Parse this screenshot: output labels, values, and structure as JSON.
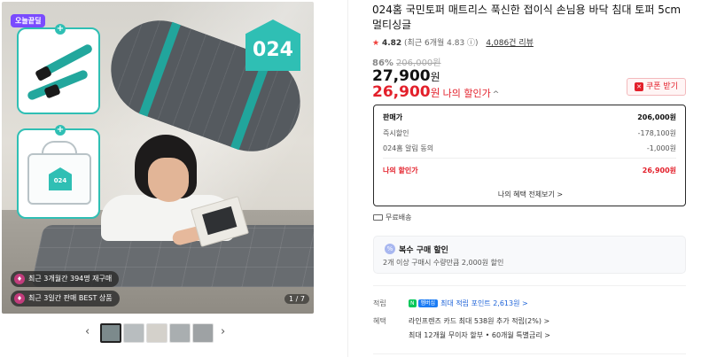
{
  "gallery": {
    "badge_today": "오늘끝딜",
    "brand_logo": "024",
    "bag_logo": "024",
    "overlay_1": "최근 3개월간 394명 재구매",
    "overlay_2": "최근 3일간 판매 BEST 상품",
    "counter": "1 / 7",
    "thumb_count": 5,
    "prev_icon": "chevron-left-icon",
    "next_icon": "chevron-right-icon"
  },
  "product": {
    "title": "024홈 국민토퍼 매트리스 푹신한 접이식 손님용 바닥 침대 토퍼 5cm 멀티싱글",
    "rating_star": "★",
    "rating_score": "4.82",
    "rating_sub": "(최근 6개월 4.83 ⓘ)",
    "reviews": "4,086건 리뷰",
    "discount_pct": "86%",
    "original_price": "206,000원",
    "price": "27,900",
    "price_unit": "원",
    "my_price": "26,900",
    "my_price_unit": "원",
    "my_price_label": "나의 할인가",
    "my_price_caret": "^",
    "coupon_label": "쿠폰 받기"
  },
  "breakdown": {
    "sale_label": "판매가",
    "sale_value": "206,000원",
    "immediate_label": "즉시할인",
    "immediate_value": "-178,100원",
    "alarm_label": "024홈 알림 동의",
    "alarm_value": "-1,000원",
    "mine_label": "나의 할인가",
    "mine_value": "26,900원",
    "link": "나의 혜택 전체보기 >"
  },
  "shipping": {
    "label": "무료배송"
  },
  "multi_buy": {
    "title": "복수 구매 할인",
    "desc": "2개 이상 구매시 수량만큼 2,000원 할인"
  },
  "meta": {
    "point_label": "적립",
    "npay": "N",
    "npay_plus": "멤버십",
    "point_value": "최대 적립 포인트 2,613원 >",
    "benefit_label": "혜택",
    "benefit_value": "라인프렌즈 카드 최대 538원 추가 적립(2%) >",
    "benefit_value2": "최대 12개월 무이자 할부 • 60개월 특별금리 >"
  },
  "colors": {
    "accent_red": "#e3202b",
    "brand_teal": "#2fbfb4",
    "badge_purple": "#7a4bff"
  }
}
